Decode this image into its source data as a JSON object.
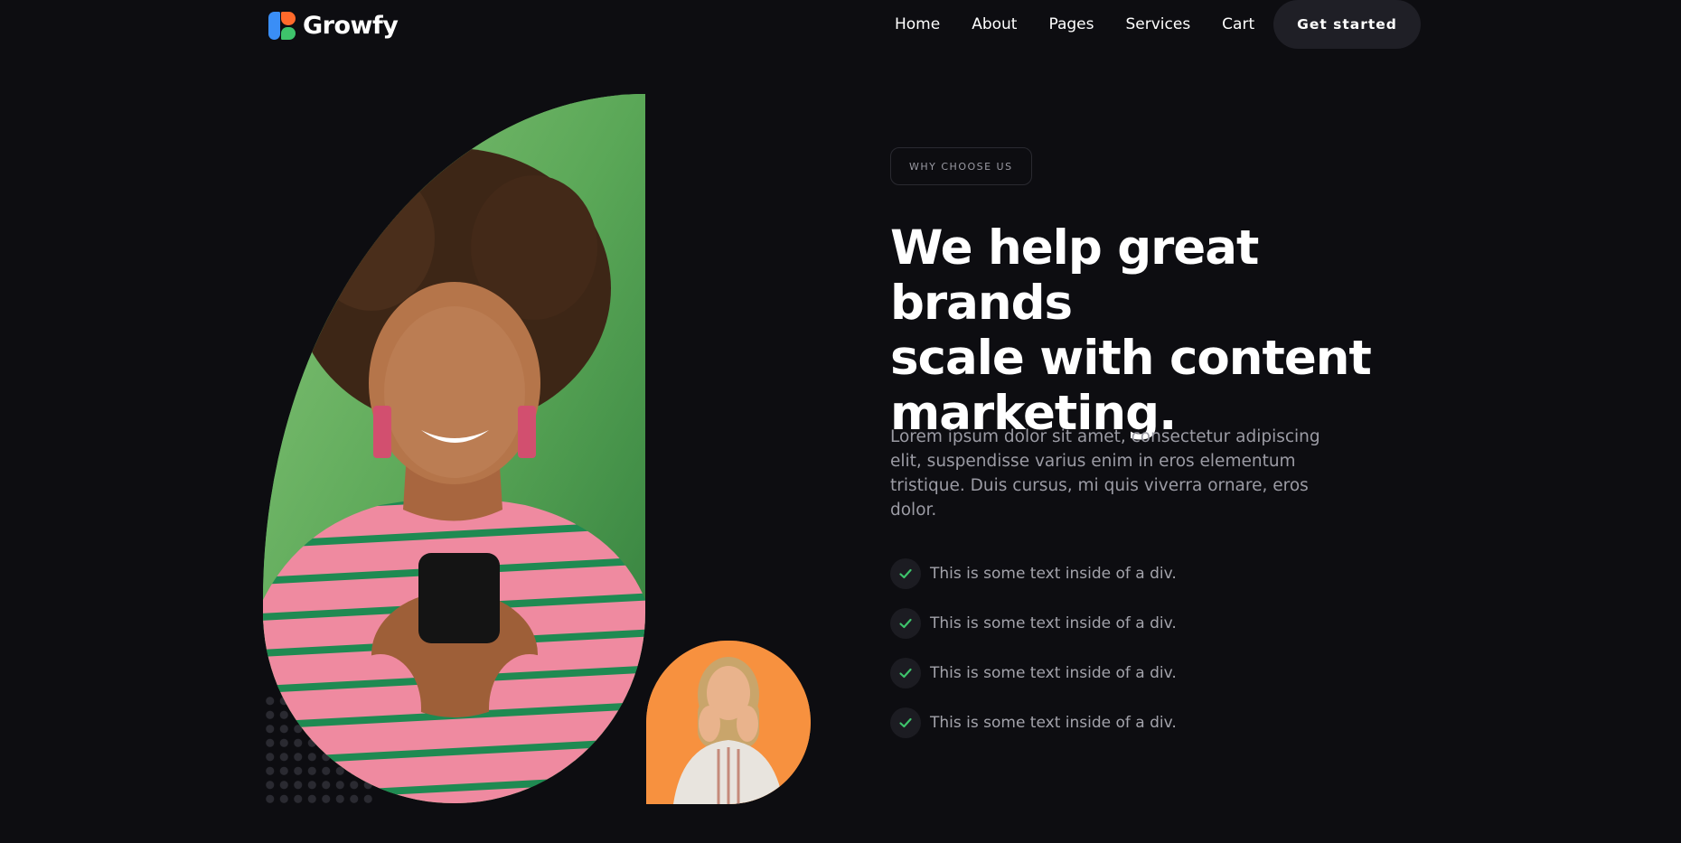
{
  "brand": {
    "name": "Growfy"
  },
  "nav": {
    "links": [
      {
        "label": "Home"
      },
      {
        "label": "About"
      },
      {
        "label": "Pages"
      },
      {
        "label": "Services"
      },
      {
        "label": "Cart"
      }
    ],
    "cta_label": "Get started"
  },
  "hero": {
    "eyebrow": "WHY CHOOSE US",
    "headline_lines": [
      "We help great brands",
      "scale with content",
      "marketing."
    ],
    "description": "Lorem ipsum dolor sit amet, consectetur adipiscing elit, suspendisse varius enim in eros elementum tristique. Duis cursus, mi quis viverra ornare, eros dolor.",
    "checklist": [
      {
        "text": "This is some text inside of a div.",
        "icon": "check-icon"
      },
      {
        "text": "This is some text inside of a div.",
        "icon": "check-icon"
      },
      {
        "text": "This is some text inside of a div.",
        "icon": "check-icon"
      },
      {
        "text": "This is some text inside of a div.",
        "icon": "check-icon"
      }
    ]
  },
  "colors": {
    "background": "#0d0d11",
    "accent_green": "#3ec36b",
    "accent_blue": "#3a8ef6",
    "accent_orange": "#ff6a2b",
    "avatar_bg": "#f7913f",
    "hero_bg": "#5ca95a"
  }
}
